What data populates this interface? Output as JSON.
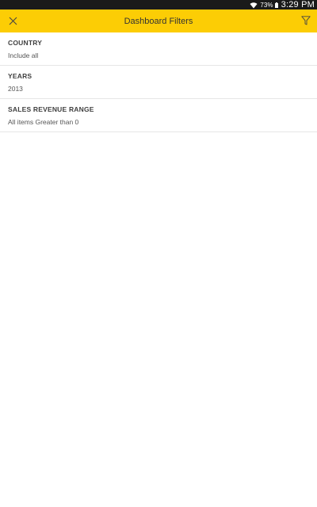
{
  "status_bar": {
    "wifi_icon": "wifi-icon",
    "battery_percent": "73%",
    "battery_icon": "battery-icon",
    "time": "3:29 PM"
  },
  "app_bar": {
    "title": "Dashboard Filters",
    "close_icon": "close-icon",
    "filter_icon": "filter-icon",
    "background_color": "#fccd05"
  },
  "filters": [
    {
      "label": "COUNTRY",
      "value": "Include all"
    },
    {
      "label": "YEARS",
      "value": "2013"
    },
    {
      "label": "SALES REVENUE RANGE",
      "value": "All items Greater than 0"
    }
  ]
}
